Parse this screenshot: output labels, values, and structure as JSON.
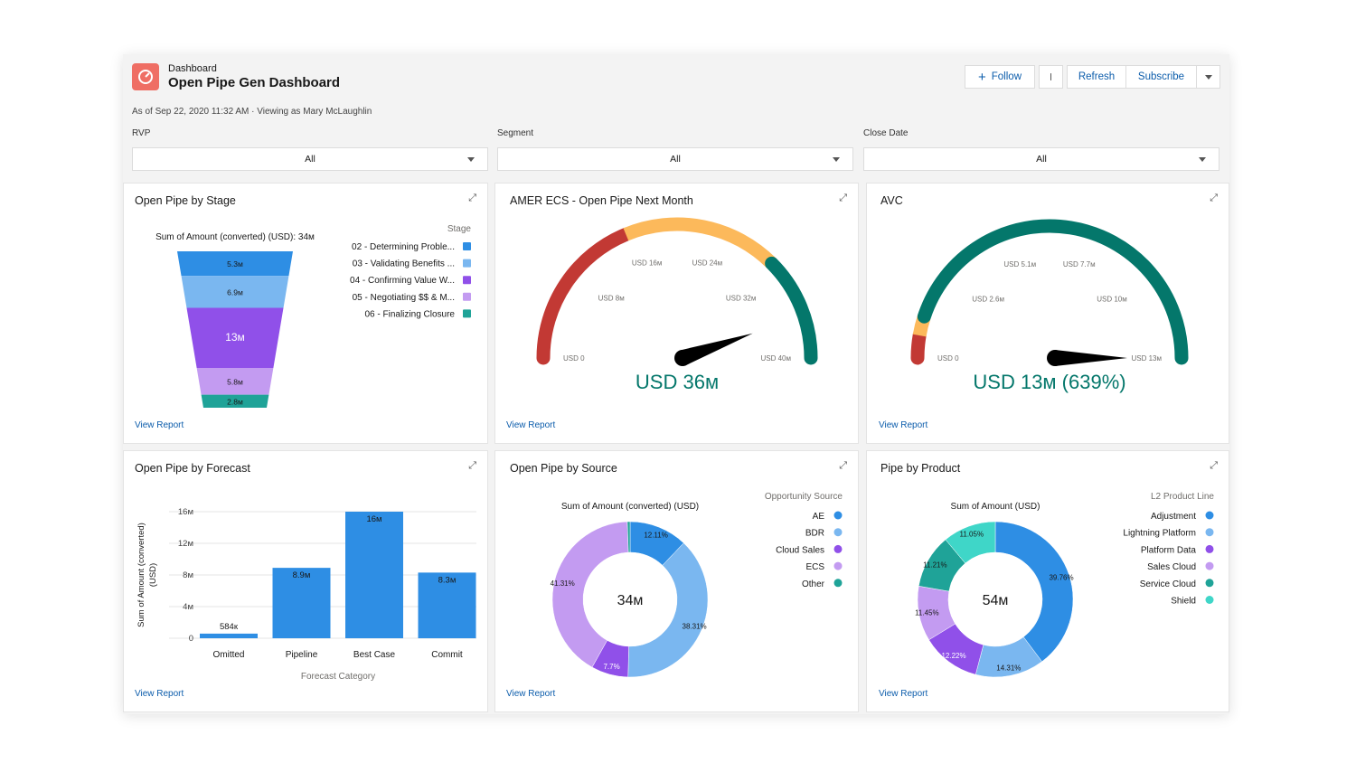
{
  "header": {
    "object_type": "Dashboard",
    "title": "Open Pipe Gen Dashboard",
    "meta": "As of Sep 22, 2020 11:32 AM · Viewing as Mary McLaughlin",
    "icon": "dashboard-gauge-icon",
    "icon_color": "#ef6e64"
  },
  "actions": {
    "follow": "Follow",
    "refresh": "Refresh",
    "subscribe": "Subscribe"
  },
  "filters": [
    {
      "label": "RVP",
      "value": "All"
    },
    {
      "label": "Segment",
      "value": "All"
    },
    {
      "label": "Close Date",
      "value": "All"
    }
  ],
  "view_report": "View Report",
  "chart_data": [
    {
      "type": "funnel",
      "title": "Open Pipe by Stage",
      "subtitle": "Sum of Amount (converted) (USD): 34м",
      "legend_title": "Stage",
      "categories": [
        "02 - Determining Proble...",
        "03 - Validating Benefits ...",
        "04 - Confirming Value W...",
        "05 - Negotiating $$ & M...",
        "06 - Finalizing Closure"
      ],
      "values": [
        5.3,
        6.9,
        13,
        5.8,
        2.8
      ],
      "labels": [
        "5.3м",
        "6.9м",
        "13м",
        "5.8м",
        "2.8м"
      ],
      "colors": [
        "#2e8ee4",
        "#7ab7f0",
        "#9050e9",
        "#c39bf1",
        "#1fa398"
      ]
    },
    {
      "type": "gauge",
      "title": "AMER ECS - Open Pipe Next Month",
      "value": 36,
      "min": 0,
      "max": 40,
      "value_label": "USD 36м",
      "ticks": [
        0,
        8,
        16,
        24,
        32,
        40
      ],
      "tick_labels": [
        "USD 0",
        "USD 8м",
        "USD 16м",
        "USD 24м",
        "USD 32м",
        "USD 40м"
      ],
      "bands": [
        {
          "from": 0,
          "to": 15,
          "color": "#c23934"
        },
        {
          "from": 15,
          "to": 30,
          "color": "#fcb95b"
        },
        {
          "from": 30,
          "to": 40,
          "color": "#04776b"
        }
      ]
    },
    {
      "type": "gauge",
      "title": "AVC",
      "value": 12.8,
      "min": 0,
      "max": 12.8,
      "value_label": "USD 13м (639%)",
      "ticks": [
        0,
        2.56,
        5.12,
        7.68,
        10.24,
        12.8
      ],
      "tick_labels": [
        "USD 0",
        "USD 2.6м",
        "USD 5.1м",
        "USD 7.7м",
        "USD 10м",
        "USD 13м"
      ],
      "bands": [
        {
          "from": 0,
          "to": 0.7,
          "color": "#c23934"
        },
        {
          "from": 0.7,
          "to": 1.3,
          "color": "#fcb95b"
        },
        {
          "from": 1.3,
          "to": 12.8,
          "color": "#04776b"
        }
      ]
    },
    {
      "type": "bar",
      "title": "Open Pipe by Forecast",
      "categories": [
        "Omitted",
        "Pipeline",
        "Best Case",
        "Commit"
      ],
      "values": [
        0.584,
        8.9,
        16,
        8.3
      ],
      "labels": [
        "584к",
        "8.9м",
        "16м",
        "8.3м"
      ],
      "ylim": [
        0,
        16
      ],
      "yticks": [
        0,
        4,
        8,
        12,
        16
      ],
      "ytick_labels": [
        "0",
        "4м",
        "8м",
        "12м",
        "16м"
      ],
      "xlabel": "Forecast Category",
      "ylabel": "Sum of Amount (converted) (USD)",
      "color": "#2e8ee4",
      "grid": true
    },
    {
      "type": "pie",
      "title": "Open Pipe by Source",
      "subtitle": "Sum of Amount (converted) (USD)",
      "center_label": "34м",
      "legend_title": "Opportunity Source",
      "categories": [
        "AE",
        "BDR",
        "Cloud Sales",
        "ECS",
        "Other"
      ],
      "values": [
        12.11,
        38.31,
        7.7,
        41.31,
        0.57
      ],
      "labels": [
        "12.11%",
        "38.31%",
        "7.7%",
        "41.31%",
        ""
      ],
      "colors": [
        "#2e8ee4",
        "#7ab7f0",
        "#9050e9",
        "#c39bf1",
        "#1fa398"
      ]
    },
    {
      "type": "pie",
      "title": "Pipe by Product",
      "subtitle": "Sum of Amount (USD)",
      "center_label": "54м",
      "legend_title": "L2 Product Line",
      "categories": [
        "Adjustment",
        "Lightning Platform",
        "Platform Data",
        "Sales Cloud",
        "Service Cloud",
        "Shield"
      ],
      "values": [
        39.76,
        14.31,
        12.22,
        11.45,
        11.21,
        11.05
      ],
      "labels": [
        "39.76%",
        "14.31%",
        "12.22%",
        "11.45%",
        "11.21%",
        "11.05%"
      ],
      "colors": [
        "#2e8ee4",
        "#7ab7f0",
        "#9050e9",
        "#c39bf1",
        "#1fa398",
        "#3fd6c8"
      ]
    }
  ]
}
